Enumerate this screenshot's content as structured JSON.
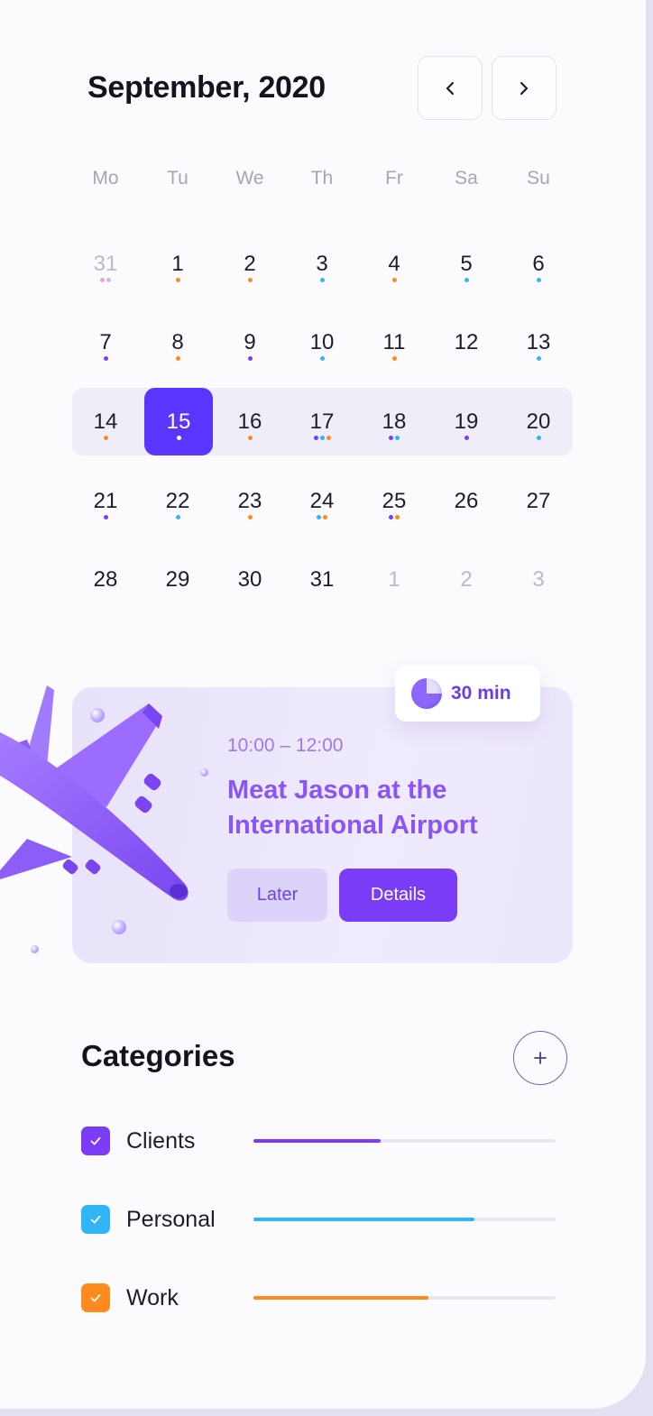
{
  "calendar": {
    "month_title": "September, 2020",
    "weekdays": [
      "Mo",
      "Tu",
      "We",
      "Th",
      "Fr",
      "Sa",
      "Su"
    ],
    "weeks": [
      [
        {
          "d": "31",
          "muted": true,
          "dots": [
            "#f0a5c8",
            "#c7bcf7"
          ]
        },
        {
          "d": "1",
          "dots": [
            "#ff8a1e"
          ]
        },
        {
          "d": "2",
          "dots": [
            "#ff8a1e"
          ]
        },
        {
          "d": "3",
          "dots": [
            "#31b5f5"
          ]
        },
        {
          "d": "4",
          "dots": [
            "#ff8a1e"
          ]
        },
        {
          "d": "5",
          "dots": [
            "#31b5f5"
          ]
        },
        {
          "d": "6",
          "dots": [
            "#31b5f5"
          ]
        }
      ],
      [
        {
          "d": "7",
          "dots": [
            "#7a3cf7"
          ]
        },
        {
          "d": "8",
          "dots": [
            "#ff8a1e"
          ]
        },
        {
          "d": "9",
          "dots": [
            "#7a3cf7"
          ]
        },
        {
          "d": "10",
          "dots": [
            "#31b5f5"
          ]
        },
        {
          "d": "11",
          "dots": [
            "#ff8a1e"
          ]
        },
        {
          "d": "12",
          "dots": []
        },
        {
          "d": "13",
          "dots": [
            "#31b5f5"
          ]
        }
      ],
      [
        {
          "d": "14",
          "dots": [
            "#ff8a1e"
          ]
        },
        {
          "d": "15",
          "selected": true,
          "dots": [
            "#ffffff"
          ]
        },
        {
          "d": "16",
          "dots": [
            "#ff8a1e"
          ]
        },
        {
          "d": "17",
          "dots": [
            "#7a3cf7",
            "#31b5f5",
            "#ff8a1e"
          ]
        },
        {
          "d": "18",
          "dots": [
            "#7a3cf7",
            "#31b5f5"
          ]
        },
        {
          "d": "19",
          "dots": [
            "#7a3cf7"
          ]
        },
        {
          "d": "20",
          "dots": [
            "#31b5f5"
          ]
        }
      ],
      [
        {
          "d": "21",
          "dots": [
            "#7a3cf7"
          ]
        },
        {
          "d": "22",
          "dots": [
            "#31b5f5"
          ]
        },
        {
          "d": "23",
          "dots": [
            "#ff8a1e"
          ]
        },
        {
          "d": "24",
          "dots": [
            "#31b5f5",
            "#ff8a1e"
          ]
        },
        {
          "d": "25",
          "dots": [
            "#7a3cf7",
            "#ff8a1e"
          ]
        },
        {
          "d": "26",
          "dots": []
        },
        {
          "d": "27",
          "dots": []
        }
      ],
      [
        {
          "d": "28",
          "dots": []
        },
        {
          "d": "29",
          "dots": []
        },
        {
          "d": "30",
          "dots": []
        },
        {
          "d": "31",
          "dots": []
        },
        {
          "d": "1",
          "muted": true,
          "dots": []
        },
        {
          "d": "2",
          "muted": true,
          "dots": []
        },
        {
          "d": "3",
          "muted": true,
          "dots": []
        }
      ]
    ],
    "prev_icon": "chevron-left-icon",
    "next_icon": "chevron-right-icon"
  },
  "event": {
    "duration": "30 min",
    "time": "10:00 – 12:00",
    "title": "Meat Jason at the International Airport",
    "later_label": "Later",
    "details_label": "Details",
    "illustration": "airplane-illustration"
  },
  "categories": {
    "title": "Categories",
    "add_icon": "plus-icon",
    "items": [
      {
        "label": "Clients",
        "color": "#7a3cf7",
        "progress": 0.42,
        "checked": true
      },
      {
        "label": "Personal",
        "color": "#31b5f5",
        "progress": 0.73,
        "checked": true
      },
      {
        "label": "Work",
        "color": "#ff8a1e",
        "progress": 0.58,
        "checked": true
      }
    ]
  },
  "colors": {
    "accent": "#5a35ff",
    "purple": "#7a3cf7",
    "blue": "#31b5f5",
    "orange": "#ff8a1e"
  }
}
